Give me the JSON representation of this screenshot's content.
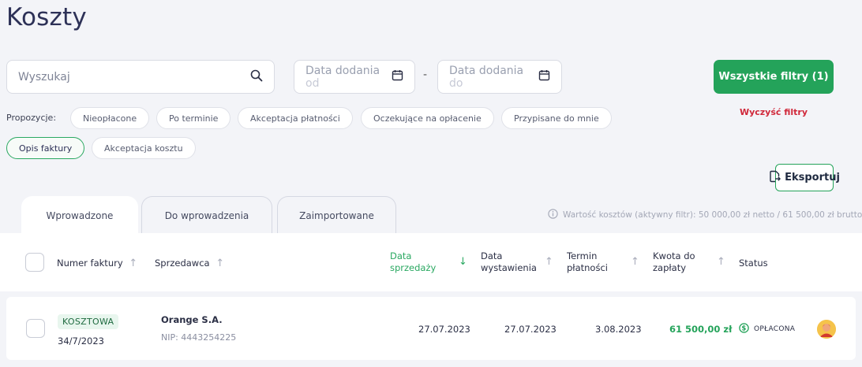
{
  "page": {
    "title": "Koszty"
  },
  "filters": {
    "search_placeholder": "Wyszukaj",
    "date_from_placeholder": "Data dodania od",
    "date_from_main": "Data dodania ",
    "date_from_tail": "od",
    "date_separator": "-",
    "date_to_main": "Data dodania ",
    "date_to_tail": "do",
    "all_filters_label": "Wszystkie filtry (1)",
    "clear_label": "Wyczyść filtry"
  },
  "suggestions": {
    "label": "Propozycje:",
    "chips": [
      {
        "label": "Nieopłacone",
        "active": false
      },
      {
        "label": "Po terminie",
        "active": false
      },
      {
        "label": "Akceptacja płatności",
        "active": false
      },
      {
        "label": "Oczekujące na opłacenie",
        "active": false
      },
      {
        "label": "Przypisane do mnie",
        "active": false
      },
      {
        "label": "Opis faktury",
        "active": true
      },
      {
        "label": "Akceptacja kosztu",
        "active": false
      }
    ]
  },
  "export_label": "Eksportuj",
  "tabs": [
    {
      "label": "Wprowadzone",
      "active": true
    },
    {
      "label": "Do wprowadzenia",
      "active": false
    },
    {
      "label": "Zaimportowane",
      "active": false
    }
  ],
  "summary_info": "Wartość kosztów (aktywny filtr): 50 000,00 zł netto / 61 500,00 zł brutto",
  "table": {
    "columns": {
      "invoice_number": "Numer faktury",
      "seller": "Sprzedawca",
      "sale_date_l1": "Data",
      "sale_date_l2": "sprzedaży",
      "issue_date_l1": "Data",
      "issue_date_l2": "wystawienia",
      "due_date_l1": "Termin",
      "due_date_l2": "płatności",
      "amount_l1": "Kwota do",
      "amount_l2": "zapłaty",
      "status": "Status"
    },
    "rows": [
      {
        "type": "KOSZTOWA",
        "invoice_number": "34/7/2023",
        "seller": "Orange S.A.",
        "nip": "NIP: 4443254225",
        "sale_date": "27.07.2023",
        "issue_date": "27.07.2023",
        "due_date": "3.08.2023",
        "amount": "61 500,00 zł",
        "status": "OPŁACONA"
      }
    ]
  }
}
